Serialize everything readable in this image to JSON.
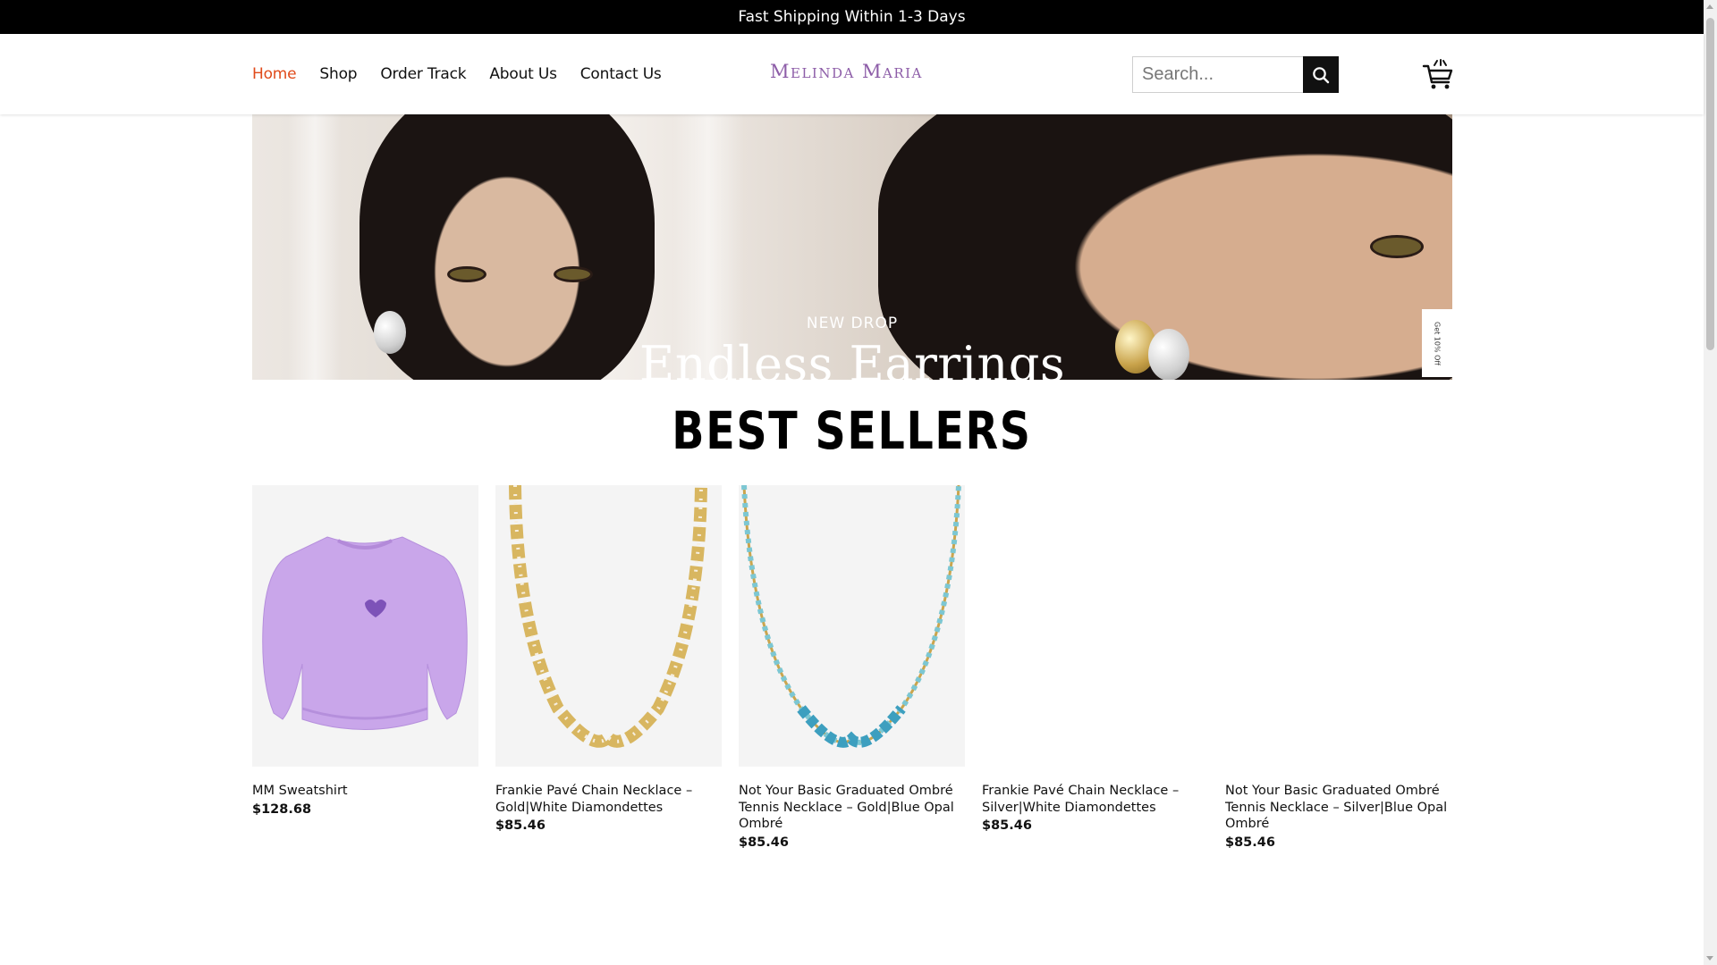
{
  "announcement": "Fast Shipping Within 1-3 Days",
  "nav": {
    "items": [
      {
        "label": "Home",
        "active": true
      },
      {
        "label": "Shop",
        "active": false
      },
      {
        "label": "Order Track",
        "active": false
      },
      {
        "label": "About Us",
        "active": false
      },
      {
        "label": "Contact Us",
        "active": false
      }
    ]
  },
  "brand": {
    "logo_text": "Melinda Maria",
    "logo_color": "#8d5da8"
  },
  "search": {
    "placeholder": "Search...",
    "icon": "search-icon"
  },
  "cart": {
    "icon": "shopping-cart-icon"
  },
  "hero": {
    "kicker": "NEW DROP",
    "headline": "Endless Earrings",
    "side_tab": "Get 10% Off"
  },
  "section": {
    "title": "BEST SELLERS"
  },
  "products": [
    {
      "name": "MM Sweatshirt",
      "price": "$128.68",
      "image": "lavender-sweatshirt"
    },
    {
      "name": "Frankie Pavé Chain Necklace – Gold|White Diamondettes",
      "price": "$85.46",
      "image": "gold-chain-necklace"
    },
    {
      "name": "Not Your Basic Graduated Ombré Tennis Necklace – Gold|Blue Opal Ombré",
      "price": "$85.46",
      "image": "blue-opal-tennis-necklace"
    },
    {
      "name": "Frankie Pavé Chain Necklace – Silver|White Diamondettes",
      "price": "$85.46",
      "image": ""
    },
    {
      "name": "Not Your Basic Graduated Ombré Tennis Necklace – Silver|Blue Opal Ombré",
      "price": "$85.46",
      "image": ""
    }
  ],
  "colors": {
    "active_nav": "#e04a1a",
    "topbar_bg": "#000000",
    "accent_dark": "#111111"
  }
}
